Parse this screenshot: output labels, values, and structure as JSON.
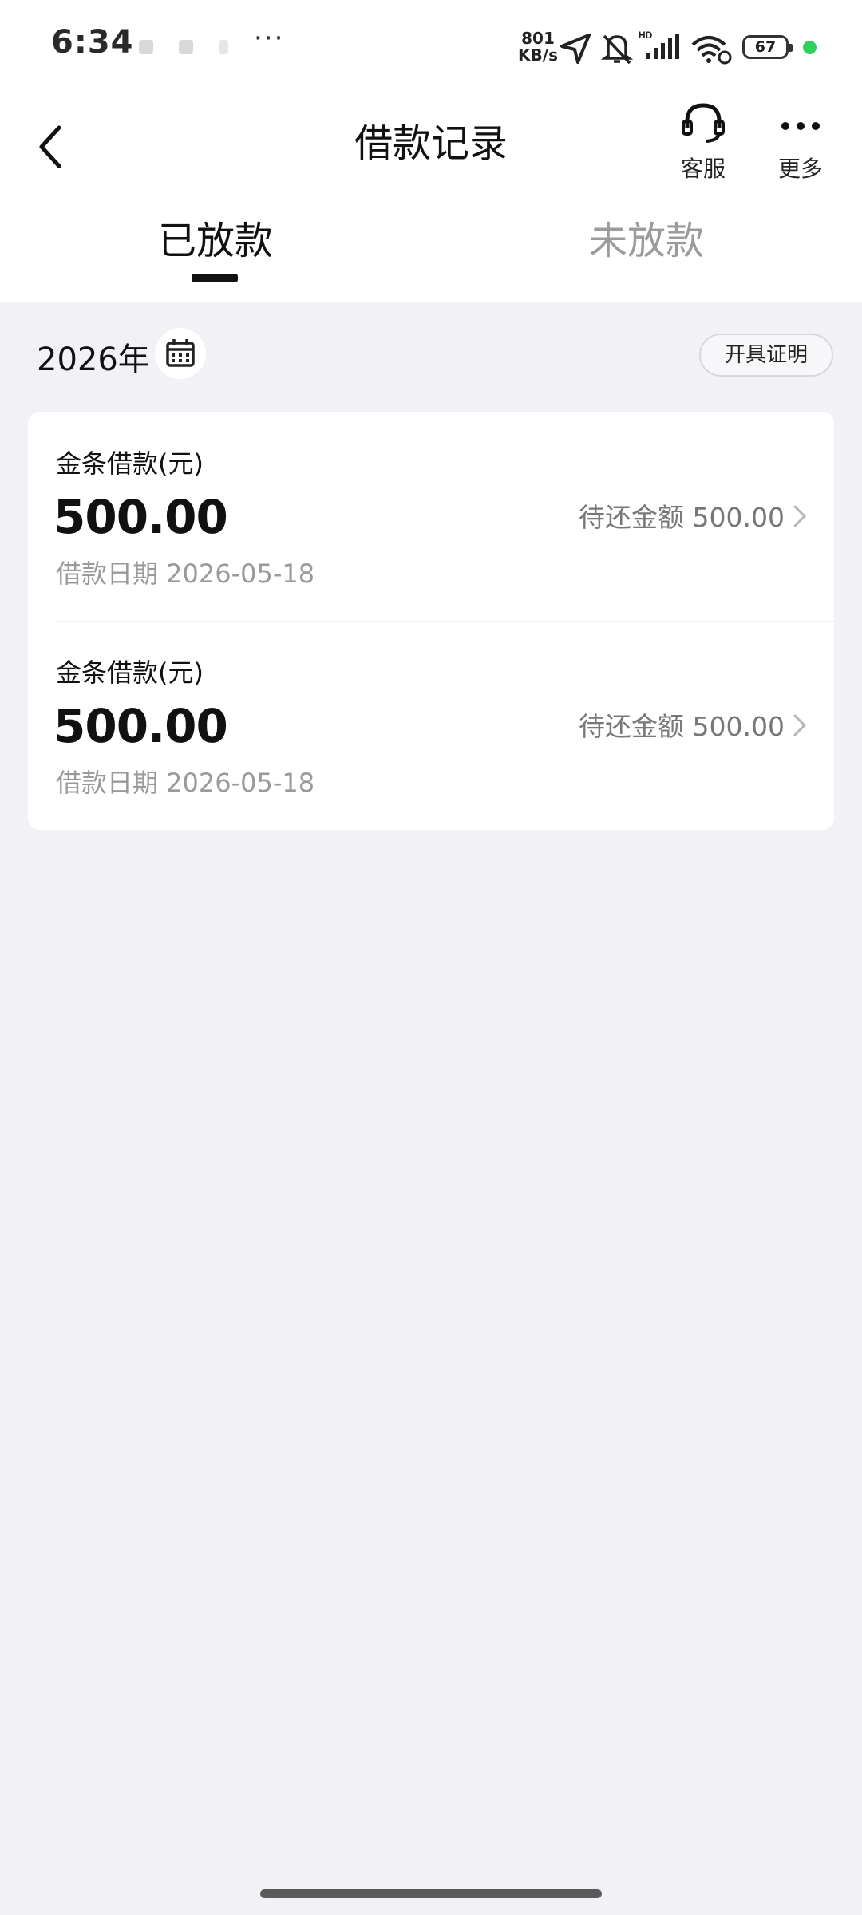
{
  "status_bar": {
    "time": "6:34",
    "more_dots": "···",
    "net_speed_value": "801",
    "net_speed_unit": "KB/s",
    "battery": "67",
    "colors": {
      "dot": "#2fd05b"
    }
  },
  "nav": {
    "title": "借款记录",
    "service_label": "客服",
    "more_label": "更多",
    "back_icon": "chevron-left-icon",
    "service_icon": "headset-icon",
    "more_icon": "more-horizontal-icon"
  },
  "tabs": [
    {
      "label": "已放款",
      "active": true
    },
    {
      "label": "未放款",
      "active": false
    }
  ],
  "filter": {
    "year": "2026年",
    "calendar_icon": "calendar-icon",
    "certificate_button": "开具证明"
  },
  "loans": [
    {
      "title": "金条借款(元)",
      "amount": "500.00",
      "date": "借款日期 2026-05-18",
      "repay": "待还金额 500.00"
    },
    {
      "title": "金条借款(元)",
      "amount": "500.00",
      "date": "借款日期 2026-05-18",
      "repay": "待还金额 500.00"
    }
  ]
}
